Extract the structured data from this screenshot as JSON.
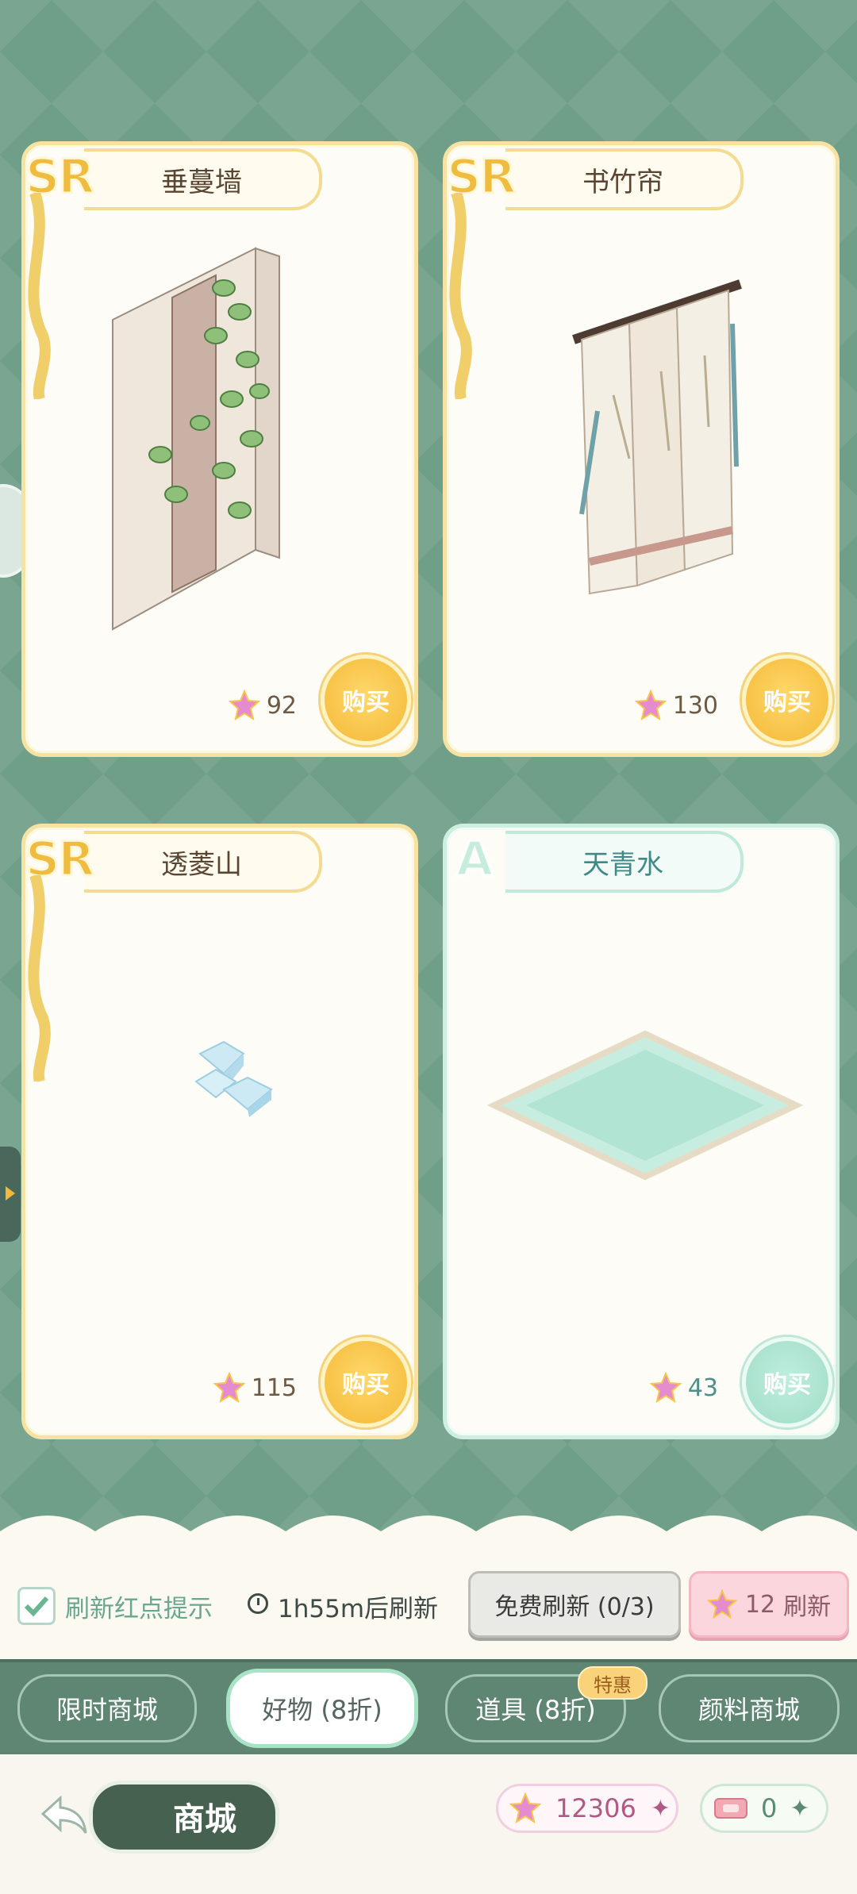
{
  "items": [
    {
      "rarity": "SR",
      "name": "垂蔓墙",
      "price": "92",
      "buy": "购买",
      "art": "vine-wall-icon"
    },
    {
      "rarity": "SR",
      "name": "书竹帘",
      "price": "130",
      "buy": "购买",
      "art": "bamboo-curtain-icon"
    },
    {
      "rarity": "SR",
      "name": "透菱山",
      "price": "115",
      "buy": "购买",
      "art": "crystal-rock-icon"
    },
    {
      "rarity": "A",
      "name": "天青水",
      "price": "43",
      "buy": "购买",
      "art": "water-tile-icon"
    }
  ],
  "refresh": {
    "tip_label": "刷新红点提示",
    "tip_checked": true,
    "timer": "1h55m后刷新",
    "free_button": "免费刷新 (0/3)",
    "paid_cost": "12",
    "paid_label": "刷新"
  },
  "tabs": [
    {
      "label": "限时商城"
    },
    {
      "label": "好物 (8折)",
      "active": true
    },
    {
      "label": "道具 (8折)",
      "badge": "特惠"
    },
    {
      "label": "颜料商城"
    }
  ],
  "footer": {
    "title": "商城",
    "star_currency": "12306",
    "ticket_currency": "0"
  },
  "colors": {
    "accent_gold": "#f3b836",
    "accent_mint": "#9fdcc6",
    "bg_green": "#6f9e89"
  }
}
